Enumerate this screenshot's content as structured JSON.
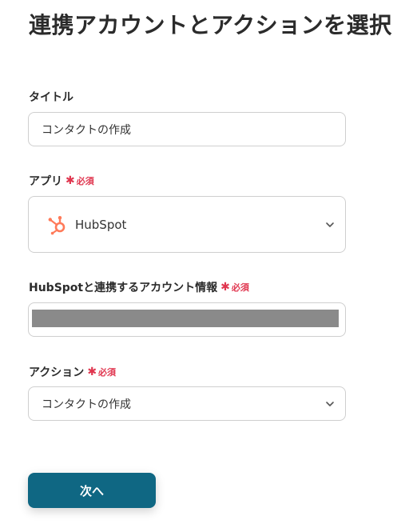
{
  "page": {
    "title": "連携アカウントとアクションを選択"
  },
  "title_field": {
    "label": "タイトル",
    "value": "コンタクトの作成"
  },
  "app_field": {
    "label": "アプリ",
    "required_label": "必須",
    "selected_app": "HubSpot",
    "icon": "hubspot-logo-icon",
    "brand_color": "#ff7a59"
  },
  "account_field": {
    "label": "HubSpotと連携するアカウント情報",
    "required_label": "必須"
  },
  "action_field": {
    "label": "アクション",
    "required_label": "必須",
    "selected_action": "コンタクトの作成"
  },
  "footer": {
    "next_label": "次へ"
  },
  "colors": {
    "required": "#e0364f",
    "primary_button": "#0f6783",
    "border": "#cfcfcf",
    "masked_fill": "#8a8a8a"
  }
}
